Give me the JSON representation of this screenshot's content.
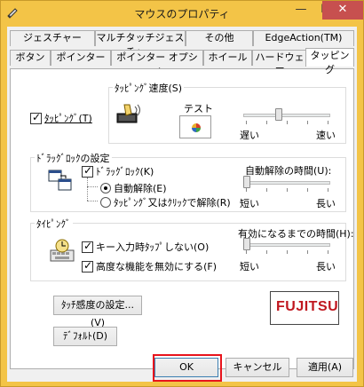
{
  "window": {
    "title": "マウスのプロパティ",
    "minimize": "—",
    "maximize": "☐",
    "close": "✕"
  },
  "tabs": {
    "back_row": [
      "ジェスチャー",
      "マルチタッチジェスチャー",
      "その他",
      "EdgeAction(TM)"
    ],
    "front_row": [
      "ボタン",
      "ポインター",
      "ポインター オプション",
      "ホイール",
      "ハードウェア",
      "タッピング"
    ],
    "active": "タッピング"
  },
  "tapping": {
    "enable_label": "ﾀｯﾋﾟﾝｸﾞ(T)",
    "enable_checked": true,
    "speed_group": "ﾀｯﾋﾟﾝｸﾞ速度(S)",
    "test_label": "テスト",
    "speed_slow": "遅い",
    "speed_fast": "速い",
    "speed_level": 0.4
  },
  "drag_lock": {
    "group": "ﾄﾞﾗｯｸﾞﾛｯｸの設定",
    "drag_lock_label": "ﾄﾞﾗｯｸﾞﾛｯｸ(K)",
    "drag_lock_checked": true,
    "auto_release": "自動解除(E)",
    "auto_release_selected": true,
    "tap_release": "ﾀｯﾋﾟﾝｸﾞ又はｸﾘｯｸで解除(R)",
    "tap_release_selected": false,
    "time_label": "自動解除の時間(U):",
    "short": "短い",
    "long": "長い",
    "time_level": 0.0
  },
  "typing": {
    "group": "ﾀｲﾋﾟﾝｸﾞ",
    "disable_on_key": "キー入力時ﾀｯﾌﾟしない(O)",
    "disable_on_key_checked": true,
    "disable_advanced": "高度な機能を無効にする(F)",
    "disable_advanced_checked": true,
    "effective_time_label": "有効になるまでの時間(H):",
    "short": "短い",
    "long": "長い",
    "effective_level": 0.0
  },
  "buttons": {
    "sensitivity": "ﾀｯﾁ感度の設定...(V)",
    "default": "ﾃﾞﾌｫﾙﾄ(D)",
    "ok": "OK",
    "cancel": "キャンセル",
    "apply": "適用(A)"
  },
  "logo_text": "FUJITSU"
}
